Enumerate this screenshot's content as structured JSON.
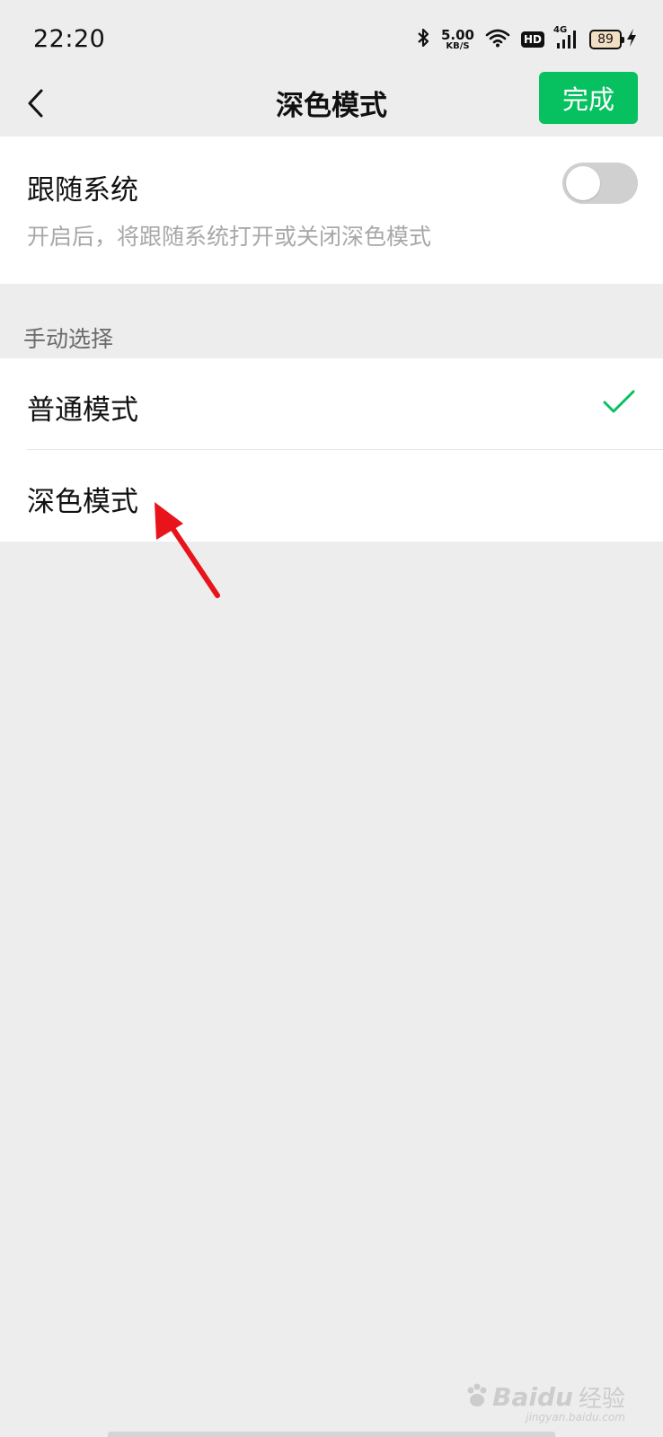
{
  "status_bar": {
    "time": "22:20",
    "net_speed_value": "5.00",
    "net_speed_unit": "KB/S",
    "hd_label": "HD",
    "network_type": "4G",
    "battery_level": "89",
    "icons": [
      "bluetooth-icon",
      "wifi-icon",
      "signal-icon",
      "battery-icon",
      "charging-icon"
    ]
  },
  "nav": {
    "back_icon": "chevron-left-icon",
    "title": "深色模式",
    "done_label": "完成",
    "done_color": "#07c160"
  },
  "follow_system": {
    "title": "跟随系统",
    "description": "开启后，将跟随系统打开或关闭深色模式",
    "enabled": false
  },
  "manual": {
    "header": "手动选择",
    "options": [
      {
        "label": "普通模式",
        "selected": true
      },
      {
        "label": "深色模式",
        "selected": false
      }
    ],
    "check_color": "#07c160"
  },
  "annotation": {
    "arrow_color": "#e8131b"
  },
  "watermark": {
    "text": "Baidu",
    "text_cn": "经验",
    "url": "jingyan.baidu.com"
  }
}
